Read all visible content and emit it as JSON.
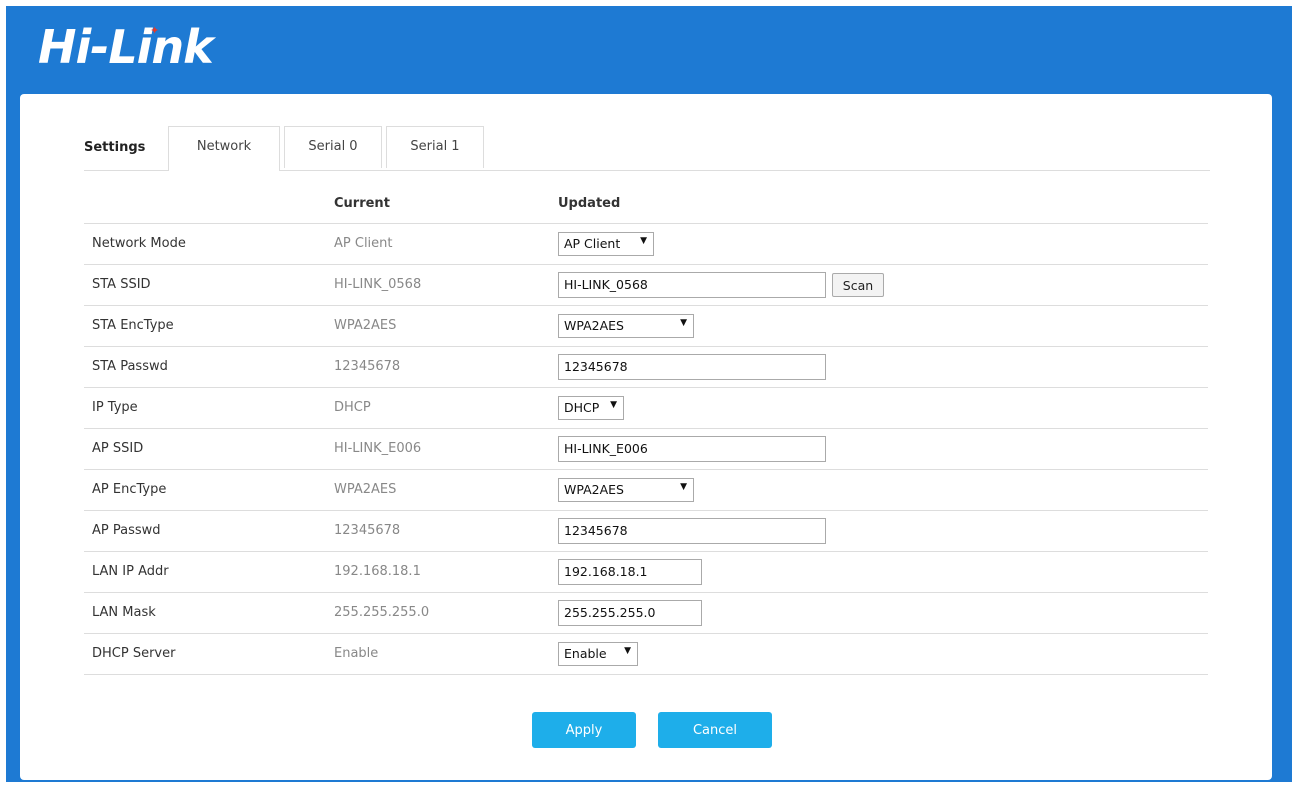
{
  "brand": {
    "logo_text": "Hi-Link",
    "logo_accent_color": "#e0392b",
    "bg_color": "#1e7ad3"
  },
  "tabs": {
    "title": "Settings",
    "items": [
      {
        "label": "Network"
      },
      {
        "label": "Serial 0"
      },
      {
        "label": "Serial 1"
      }
    ]
  },
  "table": {
    "headers": {
      "current": "Current",
      "updated": "Updated"
    },
    "rows": [
      {
        "label": "Network Mode",
        "current": "AP Client",
        "control": "select",
        "value": "AP Client"
      },
      {
        "label": "STA SSID",
        "current": "HI-LINK_0568",
        "control": "input",
        "value": "HI-LINK_0568",
        "button": "Scan"
      },
      {
        "label": "STA EncType",
        "current": "WPA2AES",
        "control": "select",
        "value": "WPA2AES"
      },
      {
        "label": "STA Passwd",
        "current": "12345678",
        "control": "input",
        "value": "12345678"
      },
      {
        "label": "IP Type",
        "current": "DHCP",
        "control": "select",
        "value": "DHCP"
      },
      {
        "label": "AP SSID",
        "current": "HI-LINK_E006",
        "control": "input",
        "value": "HI-LINK_E006"
      },
      {
        "label": "AP EncType",
        "current": "WPA2AES",
        "control": "select",
        "value": "WPA2AES"
      },
      {
        "label": "AP Passwd",
        "current": "12345678",
        "control": "input",
        "value": "12345678"
      },
      {
        "label": "LAN IP Addr",
        "current": "192.168.18.1",
        "control": "input",
        "value": "192.168.18.1"
      },
      {
        "label": "LAN Mask",
        "current": "255.255.255.0",
        "control": "input",
        "value": "255.255.255.0"
      },
      {
        "label": "DHCP Server",
        "current": "Enable",
        "control": "select",
        "value": "Enable"
      }
    ]
  },
  "actions": {
    "apply": "Apply",
    "cancel": "Cancel",
    "button_color": "#1eaeea"
  }
}
